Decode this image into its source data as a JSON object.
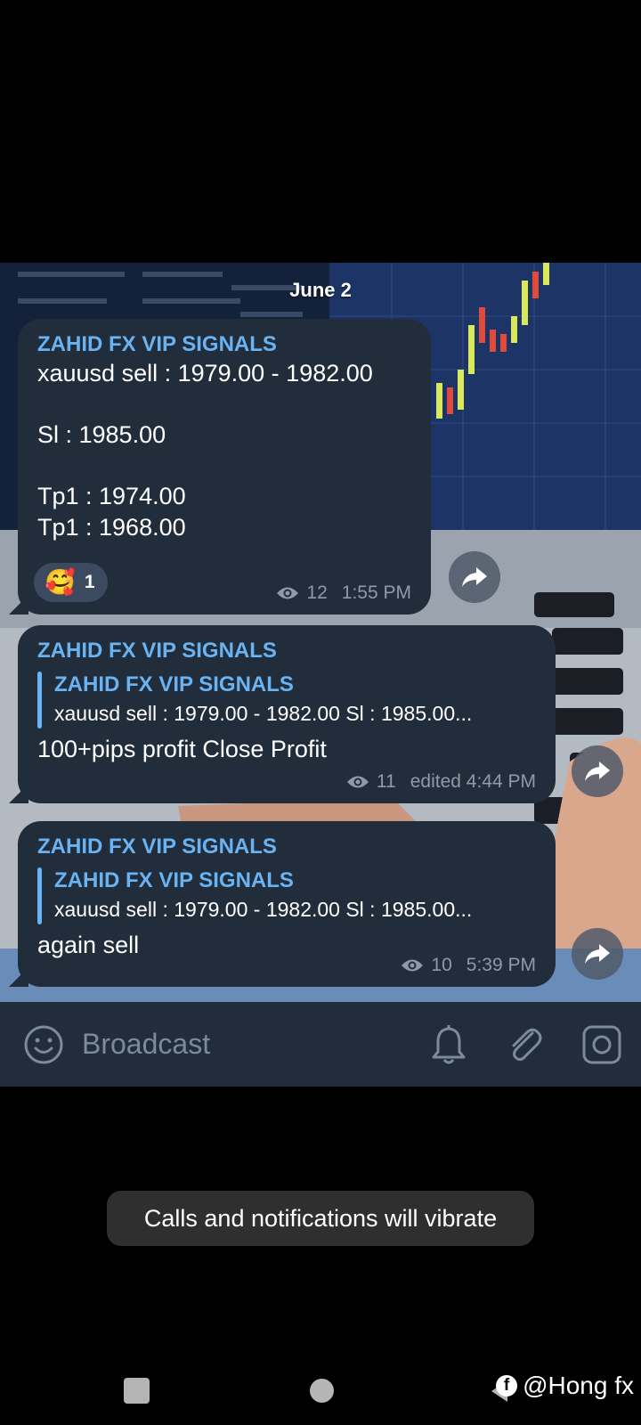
{
  "chat": {
    "date": "June 2",
    "messages": [
      {
        "sender": "ZAHID FX VIP SIGNALS",
        "line1": "xauusd sell : 1979.00 - 1982.00",
        "line2": "Sl : 1985.00",
        "line3": "Tp1 : 1974.00",
        "line4": "Tp1 : 1968.00",
        "reaction_emoji": "🥰",
        "reaction_count": "1",
        "views": "12",
        "time": "1:55 PM"
      },
      {
        "sender": "ZAHID FX VIP SIGNALS",
        "reply_title": "ZAHID FX VIP SIGNALS",
        "reply_text": "xauusd sell : 1979.00 - 1982.00  Sl : 1985.00...",
        "text": "100+pips profit Close Profit",
        "views": "11",
        "time": "edited 4:44 PM"
      },
      {
        "sender": "ZAHID FX VIP SIGNALS",
        "reply_title": "ZAHID FX VIP SIGNALS",
        "reply_text": "xauusd sell : 1979.00 - 1982.00  Sl : 1985.00...",
        "text": "again sell",
        "views": "10",
        "time": "5:39 PM"
      }
    ]
  },
  "input": {
    "placeholder": "Broadcast"
  },
  "toast": {
    "text": "Calls and notifications will vibrate"
  },
  "watermark": {
    "text": "@Hong fx"
  },
  "colors": {
    "bubble": "#212d3b",
    "sender": "#6ab3f3",
    "meta": "#8e9aa7",
    "input_bar": "#212d3b"
  },
  "icons": [
    "eye-icon",
    "share-icon",
    "smile-icon",
    "bell-icon",
    "paperclip-icon",
    "camera-icon",
    "facebook-icon"
  ]
}
